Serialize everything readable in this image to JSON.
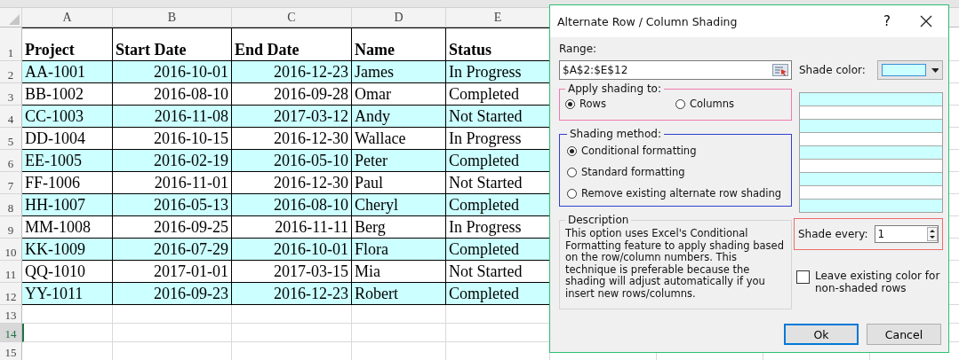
{
  "sheet": {
    "columns": [
      {
        "letter": "A",
        "kind": "text"
      },
      {
        "letter": "B",
        "kind": "date"
      },
      {
        "letter": "C",
        "kind": "date"
      },
      {
        "letter": "D",
        "kind": "text"
      },
      {
        "letter": "E",
        "kind": "text"
      }
    ],
    "header_row": {
      "number": "1",
      "cells": [
        "Project",
        "Start Date",
        "End Date",
        "Name",
        "Status"
      ]
    },
    "rows": [
      {
        "number": "2",
        "shaded": true,
        "cells": [
          "AA-1001",
          "2016-10-01",
          "2016-12-23",
          "James",
          "In Progress"
        ]
      },
      {
        "number": "3",
        "shaded": false,
        "cells": [
          "BB-1002",
          "2016-08-10",
          "2016-09-28",
          "Omar",
          "Completed"
        ]
      },
      {
        "number": "4",
        "shaded": true,
        "cells": [
          "CC-1003",
          "2016-11-08",
          "2017-03-12",
          "Andy",
          "Not Started"
        ]
      },
      {
        "number": "5",
        "shaded": false,
        "cells": [
          "DD-1004",
          "2016-10-15",
          "2016-12-30",
          "Wallace",
          "In Progress"
        ]
      },
      {
        "number": "6",
        "shaded": true,
        "cells": [
          "EE-1005",
          "2016-02-19",
          "2016-05-10",
          "Peter",
          "Completed"
        ]
      },
      {
        "number": "7",
        "shaded": false,
        "cells": [
          "FF-1006",
          "2016-11-01",
          "2016-12-30",
          "Paul",
          "Not Started"
        ]
      },
      {
        "number": "8",
        "shaded": true,
        "cells": [
          "HH-1007",
          "2016-05-13",
          "2016-08-10",
          "Cheryl",
          "Completed"
        ]
      },
      {
        "number": "9",
        "shaded": false,
        "cells": [
          "MM-1008",
          "2016-09-25",
          "2016-11-11",
          "Berg",
          "In Progress"
        ]
      },
      {
        "number": "10",
        "shaded": true,
        "cells": [
          "KK-1009",
          "2016-07-29",
          "2016-10-01",
          "Flora",
          "Completed"
        ]
      },
      {
        "number": "11",
        "shaded": false,
        "cells": [
          "QQ-1010",
          "2017-01-01",
          "2017-03-15",
          "Mia",
          "Not Started"
        ]
      },
      {
        "number": "12",
        "shaded": true,
        "cells": [
          "YY-1011",
          "2016-09-23",
          "2016-12-23",
          "Robert",
          "Completed"
        ]
      }
    ],
    "empty_rows": [
      {
        "number": "13",
        "selected": false
      },
      {
        "number": "14",
        "selected": true
      },
      {
        "number": "15",
        "selected": false
      }
    ]
  },
  "dialog": {
    "title": "Alternate Row / Column Shading",
    "help": "?",
    "range": {
      "label": "Range:",
      "value": "$A$2:$E$12"
    },
    "shade_color": {
      "label": "Shade color:",
      "color": "#ccffff"
    },
    "apply_to": {
      "legend": "Apply shading to:",
      "options": [
        {
          "label": "Rows",
          "selected": true
        },
        {
          "label": "Columns",
          "selected": false
        }
      ]
    },
    "method": {
      "legend": "Shading method:",
      "options": [
        {
          "label": "Conditional formatting",
          "selected": true
        },
        {
          "label": "Standard formatting",
          "selected": false
        },
        {
          "label": "Remove existing alternate row shading",
          "selected": false
        }
      ]
    },
    "description": {
      "legend": "Description",
      "text": "This option uses Excel's Conditional Formatting feature to apply shading based on the row/column numbers. This technique is preferable because the shading will adjust automatically if you insert new rows/columns."
    },
    "shade_every": {
      "label": "Shade every:",
      "value": "1"
    },
    "leave_color": {
      "label": "Leave existing color for non-shaded rows",
      "checked": false
    },
    "buttons": [
      {
        "label": "Ok",
        "default": true
      },
      {
        "label": "Cancel",
        "default": false
      }
    ]
  }
}
